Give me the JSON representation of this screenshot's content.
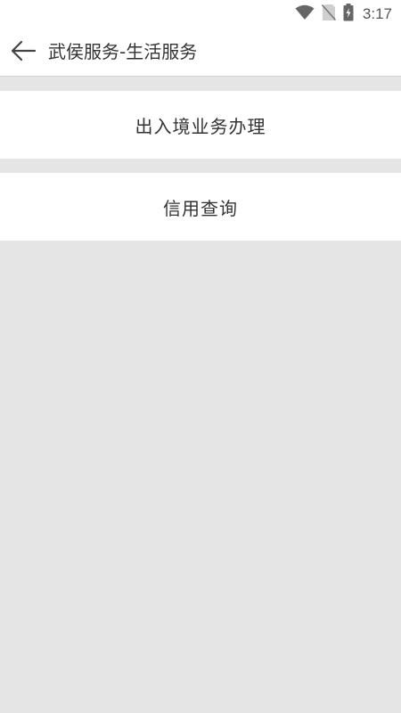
{
  "status_bar": {
    "time": "3:17",
    "icons": [
      "wifi-icon",
      "no-sim-icon",
      "battery-charging-icon"
    ]
  },
  "app_bar": {
    "back_icon": "back-arrow-icon",
    "title": "武侯服务-生活服务"
  },
  "menu": {
    "items": [
      {
        "label": "出入境业务办理"
      },
      {
        "label": "信用查询"
      }
    ]
  },
  "colors": {
    "background": "#e5e5e5",
    "surface": "#ffffff",
    "text": "#333333"
  }
}
